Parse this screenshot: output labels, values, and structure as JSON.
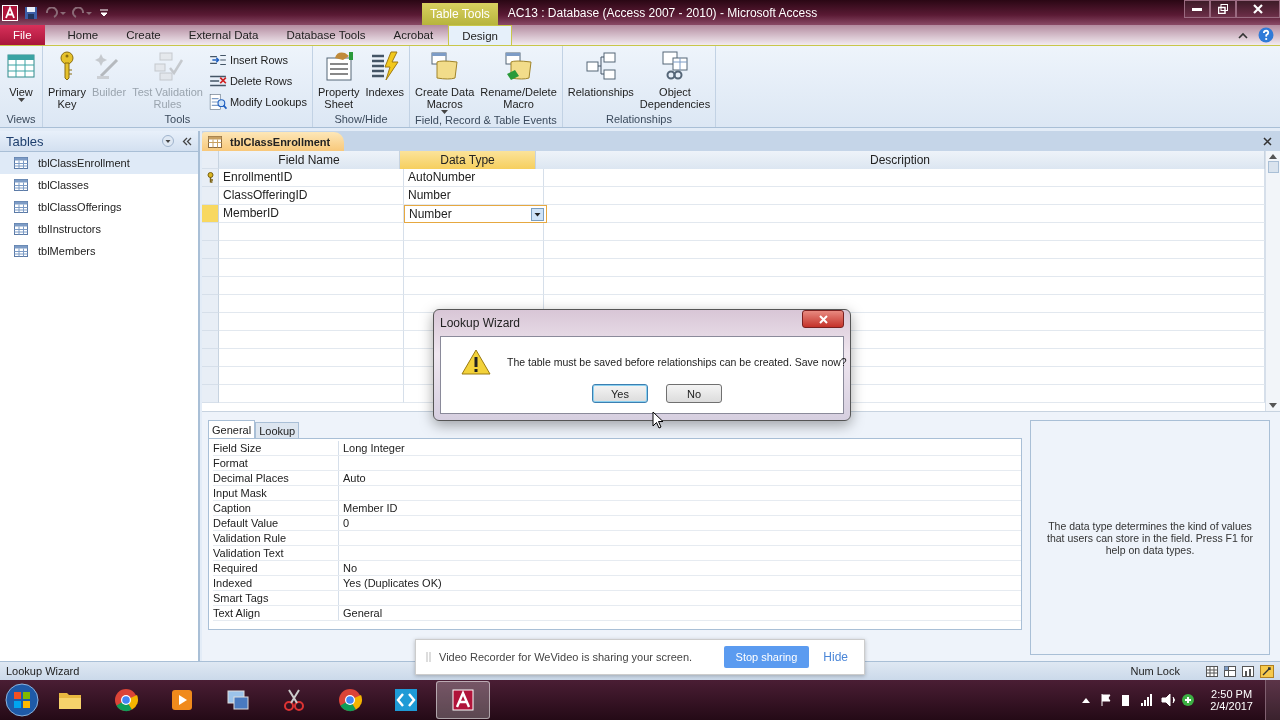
{
  "window": {
    "title": "AC13 : Database (Access 2007 - 2010)  -  Microsoft Access",
    "contextual_tab": "Table Tools"
  },
  "ribbon_tabs": [
    {
      "label": "File",
      "kind": "file",
      "selected": false
    },
    {
      "label": "Home",
      "kind": "tab",
      "selected": false
    },
    {
      "label": "Create",
      "kind": "tab",
      "selected": false
    },
    {
      "label": "External Data",
      "kind": "tab",
      "selected": false
    },
    {
      "label": "Database Tools",
      "kind": "tab",
      "selected": false
    },
    {
      "label": "Acrobat",
      "kind": "tab",
      "selected": false
    },
    {
      "label": "Design",
      "kind": "tab",
      "selected": true
    }
  ],
  "ribbon_groups": [
    {
      "label": "Views",
      "buttons": [
        {
          "kind": "large",
          "label": "View",
          "dropdown": true,
          "disabled": false
        }
      ]
    },
    {
      "label": "Tools",
      "buttons": [
        {
          "kind": "large",
          "label": "Primary\nKey",
          "dropdown": false,
          "disabled": false
        },
        {
          "kind": "large",
          "label": "Builder",
          "dropdown": false,
          "disabled": true
        },
        {
          "kind": "large",
          "label": "Test Validation\nRules",
          "dropdown": false,
          "disabled": true
        },
        {
          "kind": "small",
          "label": "Insert Rows",
          "disabled": false
        },
        {
          "kind": "small",
          "label": "Delete Rows",
          "disabled": false
        },
        {
          "kind": "small",
          "label": "Modify Lookups",
          "disabled": false
        }
      ]
    },
    {
      "label": "Show/Hide",
      "buttons": [
        {
          "kind": "large",
          "label": "Property\nSheet",
          "dropdown": false,
          "disabled": false
        },
        {
          "kind": "large",
          "label": "Indexes",
          "dropdown": false,
          "disabled": false
        }
      ]
    },
    {
      "label": "Field, Record & Table Events",
      "buttons": [
        {
          "kind": "large",
          "label": "Create Data\nMacros",
          "dropdown": true,
          "disabled": false
        },
        {
          "kind": "large",
          "label": "Rename/Delete\nMacro",
          "dropdown": false,
          "disabled": false
        }
      ]
    },
    {
      "label": "Relationships",
      "buttons": [
        {
          "kind": "large",
          "label": "Relationships",
          "dropdown": false,
          "disabled": false
        },
        {
          "kind": "large",
          "label": "Object\nDependencies",
          "dropdown": false,
          "disabled": false
        }
      ]
    }
  ],
  "navigation_pane": {
    "title": "Tables",
    "items": [
      {
        "label": "tblClassEnrollment",
        "selected": true
      },
      {
        "label": "tblClasses",
        "selected": false
      },
      {
        "label": "tblClassOfferings",
        "selected": false
      },
      {
        "label": "tblInstructors",
        "selected": false
      },
      {
        "label": "tblMembers",
        "selected": false
      }
    ]
  },
  "document_tab": "tblClassEnrollment",
  "design_grid": {
    "columns": [
      "Field Name",
      "Data Type",
      "Description"
    ],
    "rows": [
      {
        "field_name": "EnrollmentID",
        "data_type": "AutoNumber",
        "primary_key": true,
        "selected": false
      },
      {
        "field_name": "ClassOfferingID",
        "data_type": "Number",
        "primary_key": false,
        "selected": false
      },
      {
        "field_name": "MemberID",
        "data_type": "Number",
        "primary_key": false,
        "selected": true
      }
    ]
  },
  "field_properties": {
    "tabs": [
      {
        "label": "General",
        "selected": true
      },
      {
        "label": "Lookup",
        "selected": false
      }
    ],
    "rows": [
      {
        "label": "Field Size",
        "value": "Long Integer"
      },
      {
        "label": "Format",
        "value": ""
      },
      {
        "label": "Decimal Places",
        "value": "Auto"
      },
      {
        "label": "Input Mask",
        "value": ""
      },
      {
        "label": "Caption",
        "value": "Member ID"
      },
      {
        "label": "Default Value",
        "value": "0"
      },
      {
        "label": "Validation Rule",
        "value": ""
      },
      {
        "label": "Validation Text",
        "value": ""
      },
      {
        "label": "Required",
        "value": "No"
      },
      {
        "label": "Indexed",
        "value": "Yes (Duplicates OK)"
      },
      {
        "label": "Smart Tags",
        "value": ""
      },
      {
        "label": "Text Align",
        "value": "General"
      }
    ],
    "help": "The data type determines the kind of values that users can store in the field. Press F1 for help on data types."
  },
  "dialog": {
    "title": "Lookup Wizard",
    "message": "The table must be saved before relationships can be created.  Save now?",
    "buttons": [
      {
        "label": "Yes",
        "default": true
      },
      {
        "label": "No",
        "default": false
      }
    ]
  },
  "sharing_bar": {
    "message": "Video Recorder for WeVideo is sharing your screen.",
    "primary_button": "Stop sharing",
    "link": "Hide"
  },
  "status_bar": {
    "left": "Lookup Wizard",
    "num_lock": "Num Lock"
  },
  "taskbar": {
    "time": "2:50 PM",
    "date": "2/4/2017"
  }
}
